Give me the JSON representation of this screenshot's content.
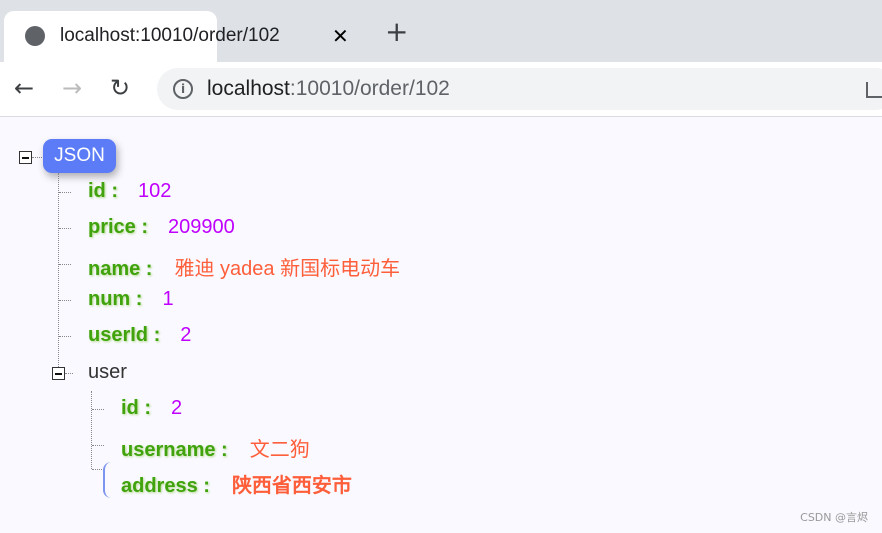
{
  "browser": {
    "tab_title": "localhost:10010/order/102",
    "url_host": "localhost",
    "url_path": ":10010/order/102"
  },
  "tree": {
    "root_label": "JSON",
    "fields": [
      {
        "key": "id :",
        "value": "102",
        "type": "number"
      },
      {
        "key": "price :",
        "value": "209900",
        "type": "number"
      },
      {
        "key": "name :",
        "value": "雅迪 yadea 新国标电动车",
        "type": "string"
      },
      {
        "key": "num :",
        "value": "1",
        "type": "number"
      },
      {
        "key": "userId :",
        "value": "2",
        "type": "number"
      }
    ],
    "user": {
      "label": "user",
      "fields": [
        {
          "key": "id :",
          "value": "2",
          "type": "number"
        },
        {
          "key": "username :",
          "value": "文二狗",
          "type": "string"
        },
        {
          "key": "address :",
          "value": "陕西省西安市",
          "type": "string"
        }
      ]
    }
  },
  "colors": {
    "key": "#40a30d",
    "number": "#c000ff",
    "string": "#ff5e3a",
    "badge": "#5b7cf6"
  },
  "watermark": "CSDN @言烬"
}
